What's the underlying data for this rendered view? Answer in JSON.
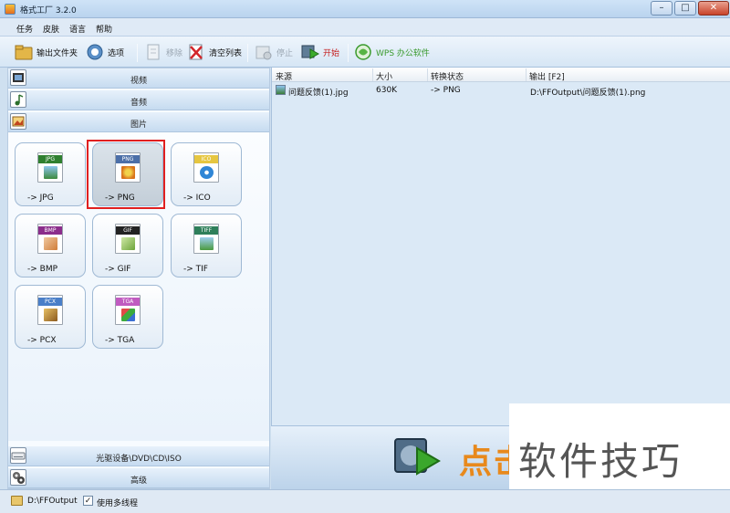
{
  "window": {
    "title": "格式工厂 3.2.0",
    "minimize": "–",
    "maximize": "□",
    "close": "✕"
  },
  "menu": [
    "任务",
    "皮肤",
    "语言",
    "帮助"
  ],
  "toolbar": {
    "output_folder": "输出文件夹",
    "options": "选项",
    "remove": "移除",
    "clear_list": "清空列表",
    "stop": "停止",
    "start": "开始",
    "wps": "WPS 办公软件"
  },
  "categories": {
    "video": "视频",
    "audio": "音频",
    "image": "图片",
    "rom": "光驱设备\\DVD\\CD\\ISO",
    "advanced": "高级"
  },
  "formats": [
    {
      "tag": "JPG",
      "label": "-> JPG",
      "tag_color": "#2f7f2f"
    },
    {
      "tag": "PNG",
      "label": "-> PNG",
      "tag_color": "#4c6fa8",
      "selected": true
    },
    {
      "tag": "ICO",
      "label": "-> ICO",
      "tag_color": "#e6c640"
    },
    {
      "tag": "BMP",
      "label": "-> BMP",
      "tag_color": "#8b2d8b"
    },
    {
      "tag": "GIF",
      "label": "-> GIF",
      "tag_color": "#222222"
    },
    {
      "tag": "TIFF",
      "label": "-> TIF",
      "tag_color": "#2e7f5a"
    },
    {
      "tag": "PCX",
      "label": "-> PCX",
      "tag_color": "#4a7fc8"
    },
    {
      "tag": "TGA",
      "label": "-> TGA",
      "tag_color": "#c05bc0"
    }
  ],
  "file_list": {
    "columns": [
      "来源",
      "大小",
      "转换状态",
      "输出 [F2]"
    ],
    "rows": [
      {
        "source": "问题反馈(1).jpg",
        "size": "630K",
        "status": "-> PNG",
        "output": "D:\\FFOutput\\问题反馈(1).png"
      }
    ]
  },
  "banner": {
    "text": "点击"
  },
  "watermark": "软件技巧",
  "status": {
    "output_path": "D:\\FFOutput",
    "multithread_label": "使用多线程",
    "multithread_checked": true,
    "check_mark": "✓"
  }
}
